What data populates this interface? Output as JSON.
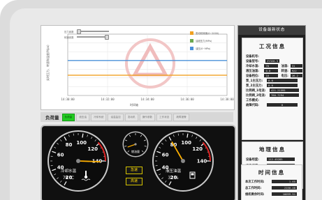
{
  "chart": {
    "ylabel": "实时压力、转速和温度(Mpa)",
    "xlabel": "时间轴",
    "x_ticks": [
      "14:30:00",
      "14:32:00",
      "14:34:00",
      "14:36:00",
      "14:38:00"
    ],
    "y_ticks": [
      "",
      "",
      "",
      "",
      "",
      "",
      ""
    ],
    "sliders": [
      "压力参数",
      "转速参数"
    ],
    "legend": [
      {
        "label": "发动机转速(0~2000)",
        "color": "#f0a020"
      },
      {
        "label": "油液压力(MPa)",
        "color": "#6aa84f"
      },
      {
        "label": "油压(0~MPa)",
        "color": "#4a90d9"
      }
    ]
  },
  "chart_data": {
    "type": "line",
    "x": [
      "14:30:00",
      "14:32:00",
      "14:34:00",
      "14:36:00",
      "14:38:00"
    ],
    "series": [
      {
        "name": "发动机转速(0~2000)",
        "color": "#f0a020",
        "values": [
          0.33,
          0.33,
          0.33,
          0.33,
          0.33
        ]
      },
      {
        "name": "油压(0~MPa)",
        "color": "#4a90d9",
        "values": [
          0.57,
          0.57,
          0.57,
          0.57,
          0.57
        ]
      }
    ],
    "ylim": [
      0,
      1
    ],
    "grid": true,
    "legend": "top-right"
  },
  "tabs": {
    "title": "负荷量",
    "items": [
      "负荷量",
      "液压油",
      "冷却系统",
      "油温监控",
      "发动机",
      "操作参数",
      "工作状态",
      "故障报警"
    ],
    "active_index": 0
  },
  "gauges": {
    "left": {
      "label": "冷却水温",
      "value_text": "78 ℃",
      "ticks": [
        "20",
        "40",
        "60",
        "80",
        "100",
        "120",
        "140"
      ]
    },
    "right": {
      "label": "液压油温",
      "value_text": "31 %",
      "ticks": [
        "20",
        "40",
        "60",
        "80",
        "100",
        "120",
        "140"
      ]
    },
    "center": {
      "label": "燃油量"
    },
    "buttons": [
      "急速",
      "高速"
    ]
  },
  "status": {
    "title": "设备最新状态",
    "work_info": {
      "heading": "工况信息",
      "rows": [
        {
          "label": "设备机号:",
          "value": ""
        },
        {
          "label": "设备型号:",
          "value": "ZY320-3"
        },
        {
          "label": "冷却水温:",
          "value": "78",
          "label2": "油温:",
          "value2": "31"
        },
        {
          "label": "液压油温:",
          "value": "0.8",
          "label2": "转速:",
          "value2": "922"
        },
        {
          "label": "设备档位:",
          "value": "10",
          "label2": "电压:",
          "value2": "26.2"
        },
        {
          "label": "泵_1主压力:",
          "value": "0.0"
        },
        {
          "label": "泵_2主压力:",
          "value": "0.0"
        },
        {
          "label": "比例阀_1电流:",
          "value": "421.21595"
        },
        {
          "label": "比例阀_2电流:",
          "value": "780.7294"
        },
        {
          "label": "工作模式:",
          "value": ""
        },
        {
          "label": "故障代码:",
          "value": "0"
        }
      ]
    },
    "geo_info": {
      "heading": "地理信息",
      "rows": [
        {
          "label": "设备经度:",
          "value": "112.45285"
        },
        {
          "label": "设备纬度:",
          "value": "39.548466"
        },
        {
          "label": "地理位置:",
          "value": "山西省 朔州市"
        }
      ],
      "extra": "朔 城 区 朔州"
    },
    "time_info": {
      "heading": "时间信息",
      "rows": [
        {
          "label": "本次工作时间:",
          "value": "1.65"
        },
        {
          "label": "总工作时间:",
          "value": "2150.48"
        },
        {
          "label": "维机剩余时间:",
          "value": "10099.51"
        }
      ]
    }
  }
}
